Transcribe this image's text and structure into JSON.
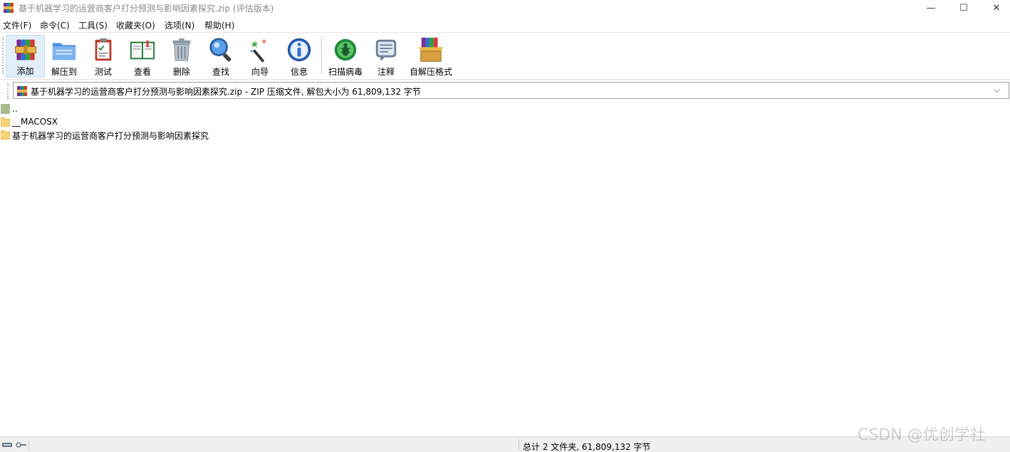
{
  "window": {
    "title": "基于机器学习的运营商客户打分预测与影响因素探究.zip (评估版本)",
    "minimize_glyph": "—",
    "maximize_glyph": "☐",
    "close_glyph": "✕"
  },
  "menu": {
    "items": [
      {
        "label": "文件(F)"
      },
      {
        "label": "命令(C)"
      },
      {
        "label": "工具(S)"
      },
      {
        "label": "收藏夹(O)"
      },
      {
        "label": "选项(N)"
      },
      {
        "label": "帮助(H)"
      }
    ]
  },
  "toolbar": {
    "buttons": [
      {
        "label": "添加",
        "icon": "add-archive-icon",
        "selected": true
      },
      {
        "label": "解压到",
        "icon": "extract-to-icon"
      },
      {
        "label": "测试",
        "icon": "test-icon"
      },
      {
        "label": "查看",
        "icon": "view-book-icon"
      },
      {
        "label": "删除",
        "icon": "trash-icon"
      },
      {
        "label": "查找",
        "icon": "magnifier-icon"
      },
      {
        "label": "向导",
        "icon": "wizard-wand-icon"
      },
      {
        "label": "信息",
        "icon": "info-icon"
      },
      {
        "label": "扫描病毒",
        "icon": "virus-scan-icon"
      },
      {
        "label": "注释",
        "icon": "comment-icon"
      },
      {
        "label": "自解压格式",
        "icon": "sfx-box-icon"
      }
    ]
  },
  "address": {
    "text": "基于机器学习的运营商客户打分预测与影响因素探究.zip - ZIP 压缩文件, 解包大小为 61,809,132 字节",
    "dropdown_glyph": "⌵"
  },
  "files": [
    {
      "name": "..",
      "type": "parent"
    },
    {
      "name": "__MACOSX",
      "type": "folder"
    },
    {
      "name": "基于机器学习的运营商客户打分预测与影响因素探究",
      "type": "folder"
    }
  ],
  "status": {
    "summary": "总计 2 文件夹, 61,809,132 字节"
  },
  "watermark": "CSDN @优创学社",
  "colors": {
    "folder_yellow": "#f6d271",
    "selected_bg": "#e3eef9",
    "title_text": "#8a8a8a"
  }
}
